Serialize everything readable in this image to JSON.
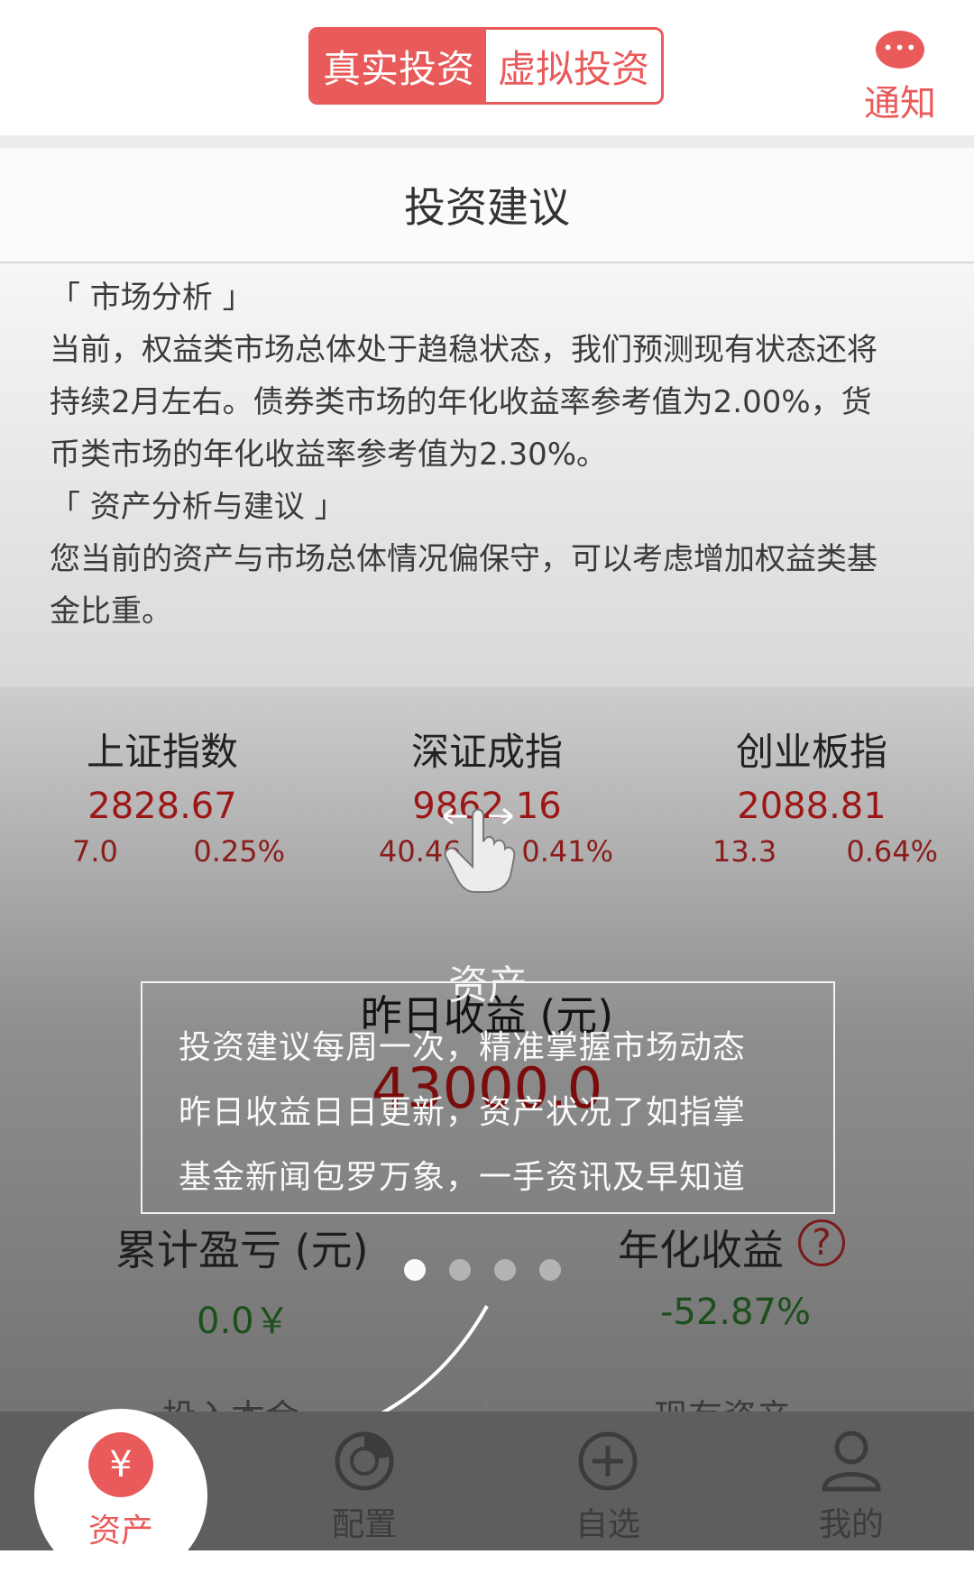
{
  "header": {
    "tab_real": "真实投资",
    "tab_virtual": "虚拟投资",
    "notice_label": "通知"
  },
  "advice": {
    "title": "投资建议",
    "lines": [
      "「 市场分析 」",
      "当前，权益类市场总体处于趋稳状态，我们预测现有状态还将",
      "持续2月左右。债券类市场的年化收益率参考值为2.00%，货",
      "币类市场的年化收益率参考值为2.30%。",
      "「 资产分析与建议 」",
      "您当前的资产与市场总体情况偏保守，可以考虑增加权益类基",
      "金比重。"
    ]
  },
  "indices": [
    {
      "name": "上证指数",
      "value": "2828.67",
      "change": "7.0",
      "pct": "0.25%"
    },
    {
      "name": "深证成指",
      "value": "9862.16",
      "change": "40.46",
      "pct": "0.41%"
    },
    {
      "name": "创业板指",
      "value": "2088.81",
      "change": "13.3",
      "pct": "0.64%"
    }
  ],
  "assets": {
    "yesterday_label": "昨日收益 (元)",
    "yesterday_value": "43000.0",
    "cumulative_label": "累计盈亏 (元)",
    "cumulative_value": "0.0￥",
    "annual_label": "年化收益",
    "annual_value": "-52.87%",
    "help": "?",
    "principal_label": "投入本金",
    "current_label": "现有资产"
  },
  "guide": {
    "title": "资产",
    "lines": [
      "投资建议每周一次，精准掌握市场动态",
      "昨日收益日日更新，资产状况了如指掌",
      "基金新闻包罗万象，一手资讯及早知道"
    ],
    "page_count": 4,
    "active_page": 1
  },
  "nav": {
    "items": [
      {
        "label": "资产",
        "icon": "yen-icon",
        "active": true
      },
      {
        "label": "配置",
        "icon": "pie-chart-icon"
      },
      {
        "label": "自选",
        "icon": "plus-circle-icon"
      },
      {
        "label": "我的",
        "icon": "user-icon"
      }
    ],
    "asset_symbol": "¥"
  },
  "colors": {
    "accent": "#e95a5a",
    "index_red": "#9c1616",
    "gain_green": "#1c4f1c"
  }
}
